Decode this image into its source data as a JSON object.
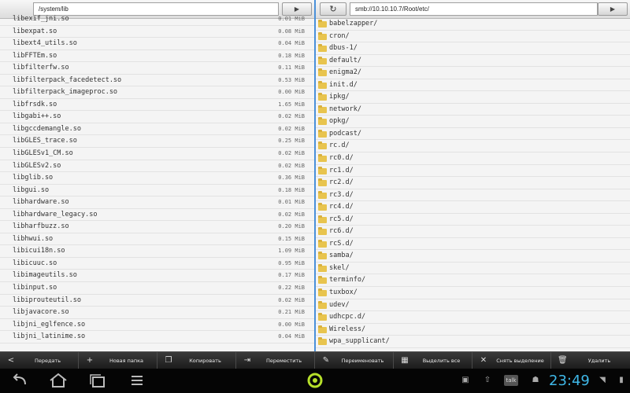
{
  "left_pane": {
    "path": "/system/lib",
    "back_glyph": "↻",
    "go_glyph": "▶",
    "files": [
      {
        "name": "libexif_jni.so",
        "size": "0.01 MiB"
      },
      {
        "name": "libexpat.so",
        "size": "0.08 MiB"
      },
      {
        "name": "libext4_utils.so",
        "size": "0.04 MiB"
      },
      {
        "name": "libFFTEm.so",
        "size": "0.18 MiB"
      },
      {
        "name": "libfilterfw.so",
        "size": "0.11 MiB"
      },
      {
        "name": "libfilterpack_facedetect.so",
        "size": "0.53 MiB"
      },
      {
        "name": "libfilterpack_imageproc.so",
        "size": "0.00 MiB"
      },
      {
        "name": "libfrsdk.so",
        "size": "1.65 MiB"
      },
      {
        "name": "libgabi++.so",
        "size": "0.02 MiB"
      },
      {
        "name": "libgccdemangle.so",
        "size": "0.02 MiB"
      },
      {
        "name": "libGLES_trace.so",
        "size": "0.25 MiB"
      },
      {
        "name": "libGLESv1_CM.so",
        "size": "0.02 MiB"
      },
      {
        "name": "libGLESv2.so",
        "size": "0.02 MiB"
      },
      {
        "name": "libglib.so",
        "size": "0.36 MiB"
      },
      {
        "name": "libgui.so",
        "size": "0.18 MiB"
      },
      {
        "name": "libhardware.so",
        "size": "0.01 MiB"
      },
      {
        "name": "libhardware_legacy.so",
        "size": "0.02 MiB"
      },
      {
        "name": "libharfbuzz.so",
        "size": "0.20 MiB"
      },
      {
        "name": "libhwui.so",
        "size": "0.15 MiB"
      },
      {
        "name": "libicui18n.so",
        "size": "1.09 MiB"
      },
      {
        "name": "libicuuc.so",
        "size": "0.95 MiB"
      },
      {
        "name": "libimageutils.so",
        "size": "0.17 MiB"
      },
      {
        "name": "libinput.so",
        "size": "0.22 MiB"
      },
      {
        "name": "libiprouteutil.so",
        "size": "0.02 MiB"
      },
      {
        "name": "libjavacore.so",
        "size": "0.21 MiB"
      },
      {
        "name": "libjni_eglfence.so",
        "size": "0.00 MiB"
      },
      {
        "name": "libjni_latinime.so",
        "size": "0.04 MiB"
      }
    ]
  },
  "right_pane": {
    "path": "smb://10.10.10.7/Root/etc/",
    "back_glyph": "↻",
    "go_glyph": "▶",
    "folders": [
      "babelzapper/",
      "cron/",
      "dbus-1/",
      "default/",
      "enigma2/",
      "init.d/",
      "ipkg/",
      "network/",
      "opkg/",
      "podcast/",
      "rc.d/",
      "rc0.d/",
      "rc1.d/",
      "rc2.d/",
      "rc3.d/",
      "rc4.d/",
      "rc5.d/",
      "rc6.d/",
      "rcS.d/",
      "samba/",
      "skel/",
      "terminfo/",
      "tuxbox/",
      "udev/",
      "udhcpc.d/",
      "Wireless/",
      "wpa_supplicant/"
    ]
  },
  "actions": {
    "send": "Передать",
    "new_folder": "Новая папка",
    "copy": "Копировать",
    "move": "Переместить",
    "rename": "Переименовать",
    "select_all": "Выделить все",
    "deselect": "Снять выделение",
    "delete": "Удалить"
  },
  "status": {
    "clock": "23:49",
    "talk_label": "talk"
  }
}
